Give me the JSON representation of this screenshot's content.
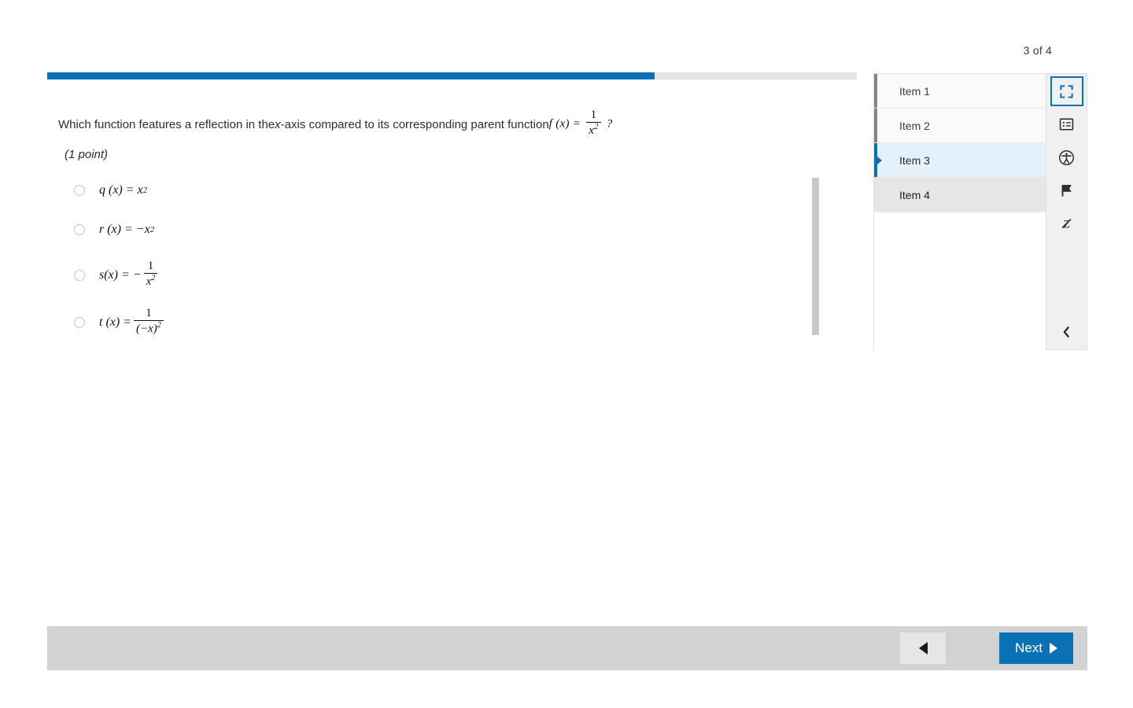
{
  "header": {
    "page_counter": "3 of 4"
  },
  "progress": {
    "percent": 75
  },
  "question": {
    "prefix": "Which function features a reflection in the ",
    "italic_var": "x",
    "suffix": "-axis compared to its corresponding parent function ",
    "formula": {
      "fn": "f (x) =",
      "numerator": "1",
      "denominator": "x",
      "denominator_exp": "2"
    },
    "question_mark": "?",
    "points": "(1 point)"
  },
  "options": [
    {
      "id": "option-q",
      "label": "q (x) = x",
      "exponent": "2",
      "type": "simple",
      "selected": false
    },
    {
      "id": "option-r",
      "label": "r (x) = −x",
      "exponent": "2",
      "type": "simple",
      "selected": false
    },
    {
      "id": "option-s",
      "label": "s(x) = −",
      "numerator": "1",
      "denominator": "x",
      "denominator_exp": "2",
      "type": "fraction",
      "selected": false
    },
    {
      "id": "option-t",
      "label": "t (x) =",
      "numerator": "1",
      "denominator": "(−x)",
      "denominator_exp": "2",
      "type": "fraction",
      "selected": false
    }
  ],
  "item_panel": {
    "items": [
      {
        "label": "Item 1",
        "state": "visited"
      },
      {
        "label": "Item 2",
        "state": "visited"
      },
      {
        "label": "Item 3",
        "state": "current"
      },
      {
        "label": "Item 4",
        "state": "hovered"
      }
    ]
  },
  "icon_rail": {
    "buttons": [
      {
        "name": "fullscreen-icon",
        "title": "Fullscreen",
        "active": true
      },
      {
        "name": "answer-eliminator-icon",
        "title": "Answer Eliminator",
        "active": false
      },
      {
        "name": "accessibility-icon",
        "title": "Accessibility",
        "active": false
      },
      {
        "name": "flag-icon",
        "title": "Flag Item",
        "active": false
      },
      {
        "name": "strikethrough-icon",
        "title": "Strikethrough",
        "active": false
      }
    ],
    "collapse": {
      "name": "chevron-left-icon",
      "title": "Collapse panel"
    }
  },
  "bottom_bar": {
    "previous_label": "",
    "next_label": "Next"
  },
  "colors": {
    "accent_blue": "#0a72b4",
    "current_item_bg": "#e4f1fb",
    "bottom_bar_bg": "#d2d2d2",
    "rail_bg": "#f0f0f0",
    "progress_track": "#e4e4e4"
  }
}
